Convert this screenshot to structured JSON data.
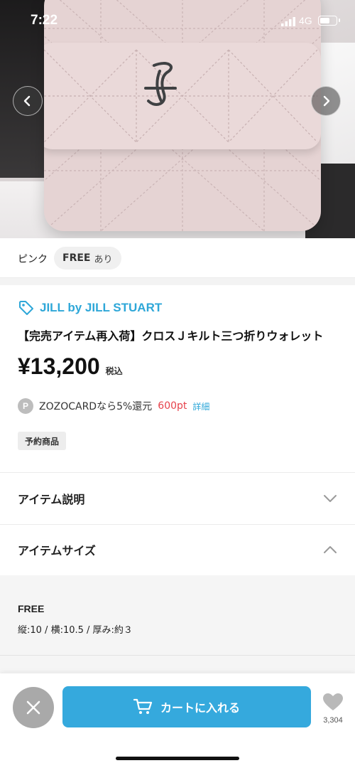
{
  "status_bar": {
    "time": "7:22",
    "network": "4G",
    "battery_level": 0.6
  },
  "gallery": {
    "prev_icon": "chevron-left-icon",
    "next_icon": "chevron-right-icon"
  },
  "variant": {
    "color": "ピンク",
    "size": "FREE",
    "stock": "あり"
  },
  "product": {
    "brand": "JILL by JILL STUART",
    "brand_icon": "tag-icon",
    "title": "【完売アイテム再入荷】クロスＪキルト三つ折りウォレット",
    "price": "¥13,200",
    "tax_label": "税込",
    "points_icon_letter": "P",
    "points_text": "ZOZOCARDなら5%還元",
    "points_value": "600pt",
    "points_detail": "詳細",
    "badge": "予約商品"
  },
  "sections": {
    "description_title": "アイテム説明",
    "size_title": "アイテムサイズ"
  },
  "size_info": {
    "name": "FREE",
    "dimensions": "縦:10 / 横:10.5 / 厚み:約３"
  },
  "bottom": {
    "cart_label": "カートに入れる",
    "favorite_count": "3,304"
  },
  "colors": {
    "accent": "#35a9dd",
    "brand_text": "#2ea7d8",
    "points_red": "#e6424b",
    "close_gray": "#a9a9a9"
  }
}
